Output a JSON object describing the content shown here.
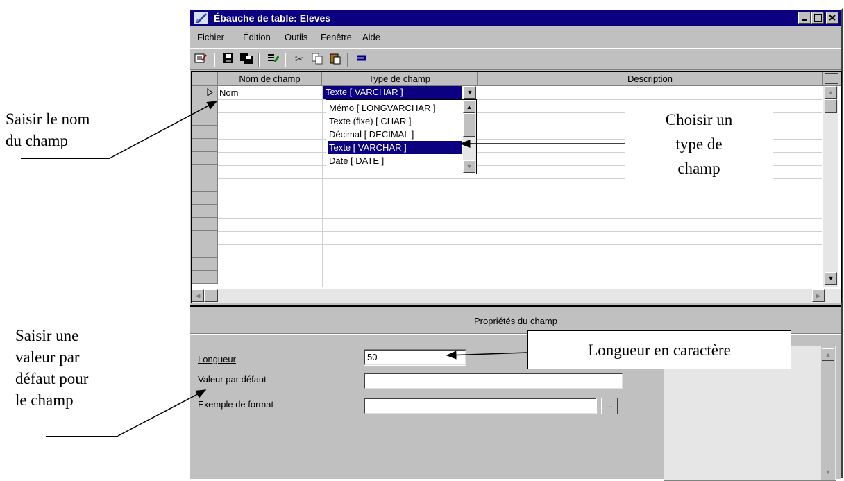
{
  "window": {
    "title": "Ébauche de table: Eleves",
    "controls": [
      "minimize-icon",
      "maximize-icon",
      "close-icon"
    ]
  },
  "menubar": {
    "items": [
      "Fichier",
      "Édition",
      "Outils",
      "Fenêtre",
      "Aide"
    ]
  },
  "toolbar": {
    "icons": [
      "design-view-icon",
      "save-icon",
      "save-all-icon",
      "index-icon",
      "cut-icon",
      "copy-icon",
      "paste-icon",
      "primary-key-icon"
    ]
  },
  "grid": {
    "columns": [
      "Nom de champ",
      "Type de champ",
      "Description"
    ],
    "row1": {
      "name": "Nom",
      "type": "Texte [ VARCHAR ]"
    }
  },
  "dropdown": {
    "options": [
      "Mémo [ LONGVARCHAR ]",
      "Texte (fixe) [ CHAR ]",
      "Décimal [ DECIMAL ]",
      "Texte [ VARCHAR ]",
      "Date [ DATE ]"
    ],
    "selected_index": 3
  },
  "properties": {
    "title": "Propriétés du champ",
    "length_label": "Longueur",
    "length_value": "50",
    "default_label": "Valeur par défaut",
    "default_value": "",
    "format_label": "Exemple de format",
    "format_value": "",
    "format_button": "..."
  },
  "annotations": {
    "name_field": [
      "Saisir le nom",
      "du champ"
    ],
    "type_field": [
      "Choisir un",
      "type de",
      "champ"
    ],
    "length_field": "Longueur en caractère",
    "default_field": [
      "Saisir une",
      "valeur par",
      "défaut pour",
      "le champ"
    ]
  }
}
